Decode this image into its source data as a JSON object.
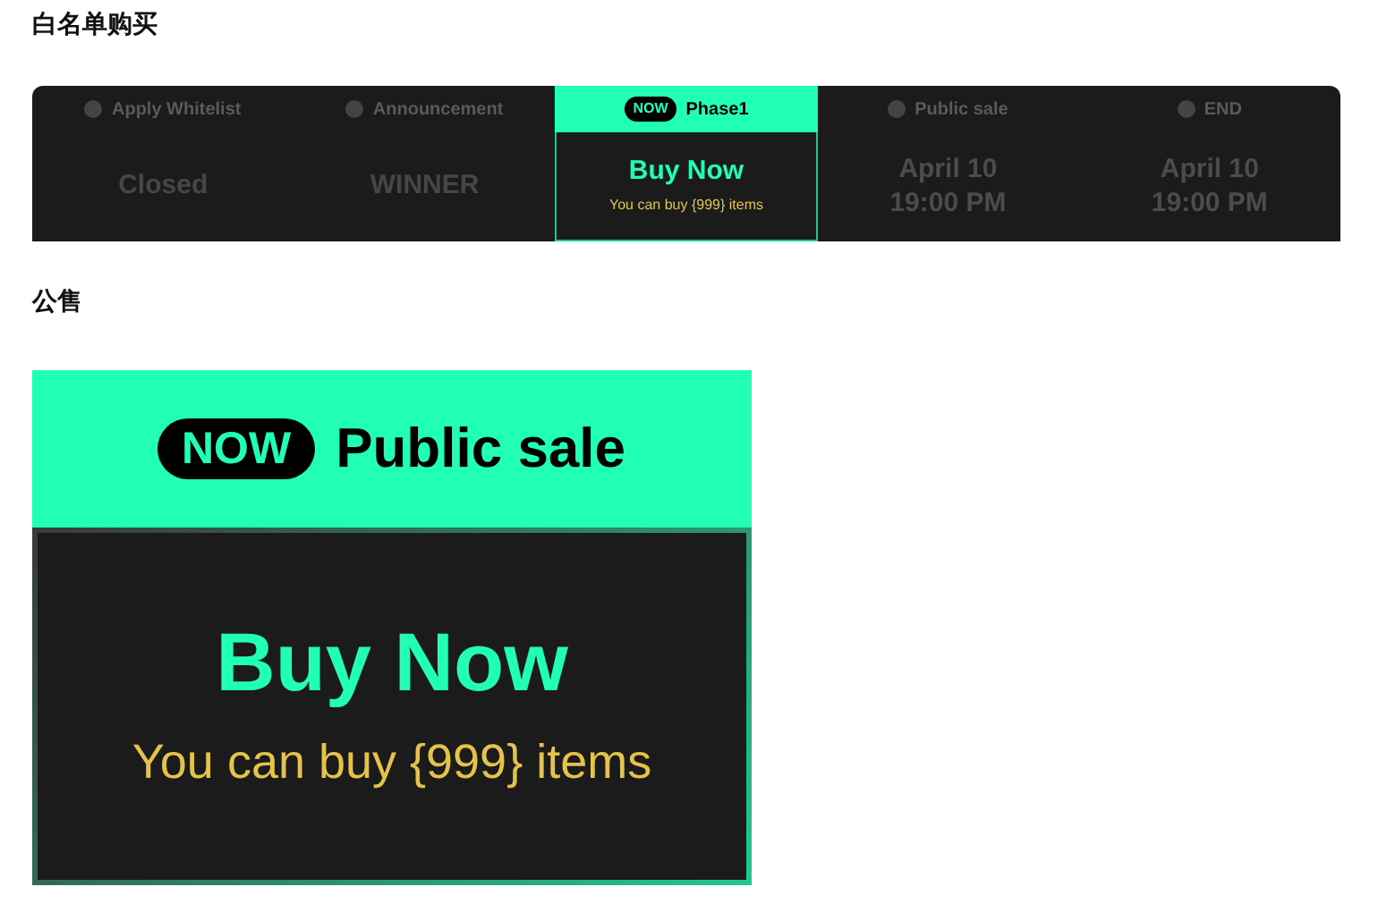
{
  "whitelist_heading": "白名单购买",
  "stages": [
    {
      "kind": "past",
      "label": "Apply Whitelist",
      "selected": false,
      "lines": [
        "Closed"
      ]
    },
    {
      "kind": "past",
      "label": "Announcement",
      "selected": false,
      "lines": [
        "WINNER"
      ]
    },
    {
      "kind": "current",
      "badge": "NOW",
      "label": "Phase1",
      "selected": true,
      "lines": [
        "Buy Now"
      ],
      "note": "You can buy {999} items"
    },
    {
      "kind": "future",
      "label": "Public sale",
      "selected": false,
      "lines": [
        "April 10",
        "19:00 PM"
      ]
    },
    {
      "kind": "future",
      "label": "END",
      "selected": false,
      "lines": [
        "April 10",
        "19:00 PM"
      ]
    }
  ],
  "public_heading": "公售",
  "public_card": {
    "badge": "NOW",
    "title": "Public sale",
    "action": "Buy Now",
    "note": "You can buy {999} items"
  }
}
